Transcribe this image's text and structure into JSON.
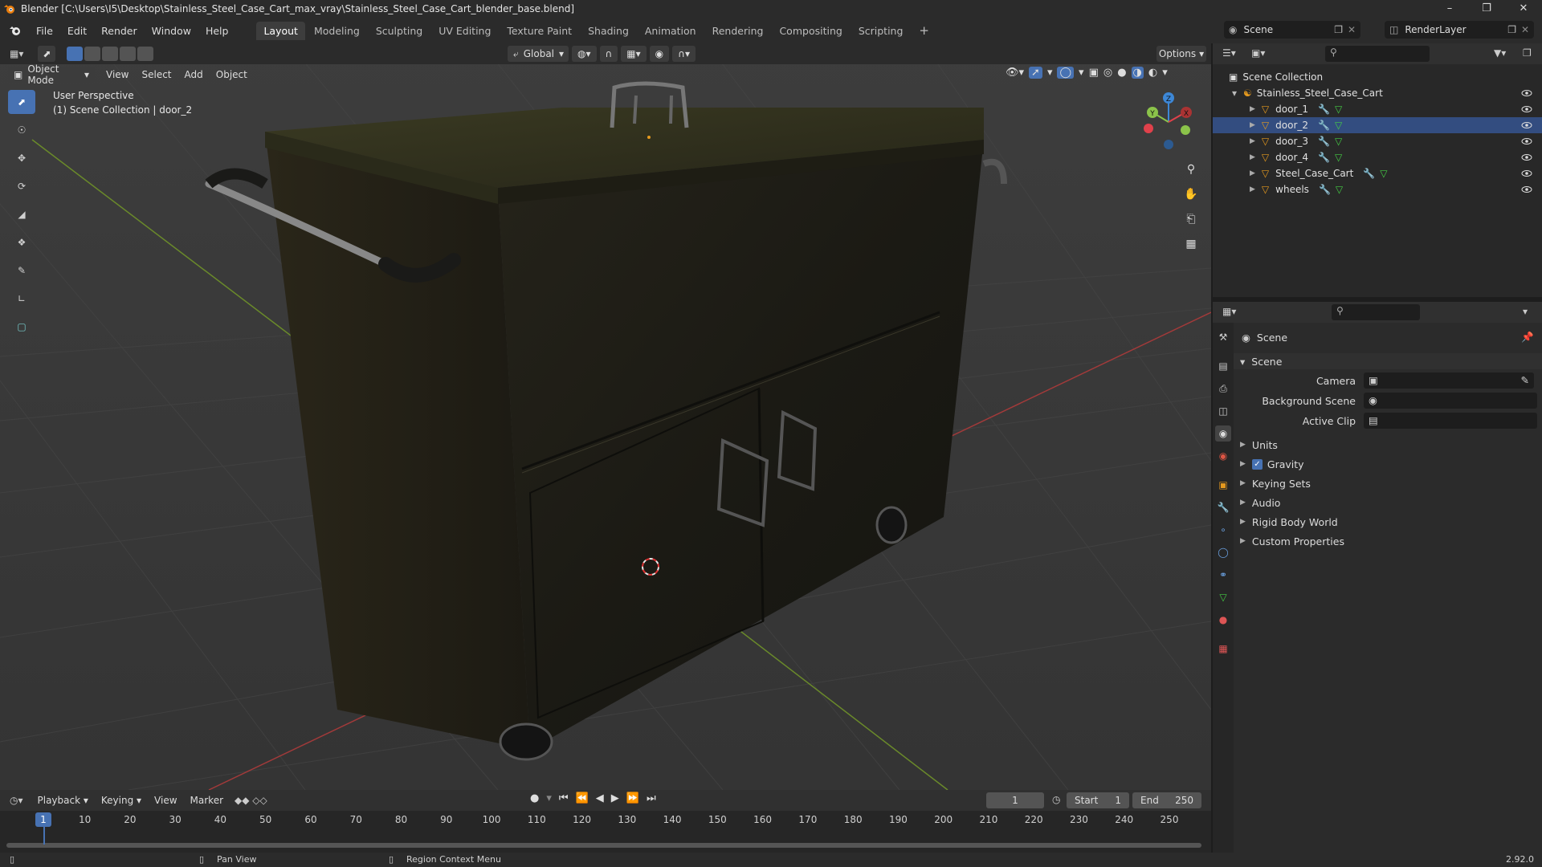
{
  "window": {
    "title": "Blender [C:\\Users\\I5\\Desktop\\Stainless_Steel_Case_Cart_max_vray\\Stainless_Steel_Case_Cart_blender_base.blend]"
  },
  "menu": {
    "items": [
      "File",
      "Edit",
      "Render",
      "Window",
      "Help"
    ],
    "workspaces": [
      "Layout",
      "Modeling",
      "Sculpting",
      "UV Editing",
      "Texture Paint",
      "Shading",
      "Animation",
      "Rendering",
      "Compositing",
      "Scripting"
    ],
    "active_workspace": "Layout",
    "scene_name": "Scene",
    "view_layer": "RenderLayer"
  },
  "viewport": {
    "mode": "Object Mode",
    "menus": [
      "View",
      "Select",
      "Add",
      "Object"
    ],
    "orientation": "Global",
    "options_label": "Options",
    "overlay_line1": "User Perspective",
    "overlay_line2": "(1) Scene Collection | door_2"
  },
  "gizmo": {
    "x": "X",
    "y": "Y",
    "z": "Z"
  },
  "timeline": {
    "menus": [
      "Playback",
      "Keying",
      "View",
      "Marker"
    ],
    "current_frame": "1",
    "start_label": "Start",
    "start": "1",
    "end_label": "End",
    "end": "250",
    "ticks": [
      "1",
      "10",
      "20",
      "30",
      "40",
      "50",
      "60",
      "70",
      "80",
      "90",
      "100",
      "110",
      "120",
      "130",
      "140",
      "150",
      "160",
      "170",
      "180",
      "190",
      "200",
      "210",
      "220",
      "230",
      "240",
      "250"
    ]
  },
  "status": {
    "pan": "Pan View",
    "context": "Region Context Menu",
    "version": "2.92.0"
  },
  "outliner": {
    "root": "Scene Collection",
    "collection": "Stainless_Steel_Case_Cart",
    "objects": [
      "door_1",
      "door_2",
      "door_3",
      "door_4",
      "Steel_Case_Cart",
      "wheels"
    ]
  },
  "properties": {
    "context": "Scene",
    "panel": "Scene",
    "camera_label": "Camera",
    "bg_label": "Background Scene",
    "clip_label": "Active Clip",
    "sections": [
      "Units",
      "Gravity",
      "Keying Sets",
      "Audio",
      "Rigid Body World",
      "Custom Properties"
    ]
  },
  "colors": {
    "accent": "#4772b3",
    "selection": "#334d80",
    "x_axis": "#e0414b",
    "y_axis": "#8bc34a",
    "z_axis": "#3d87d6"
  }
}
